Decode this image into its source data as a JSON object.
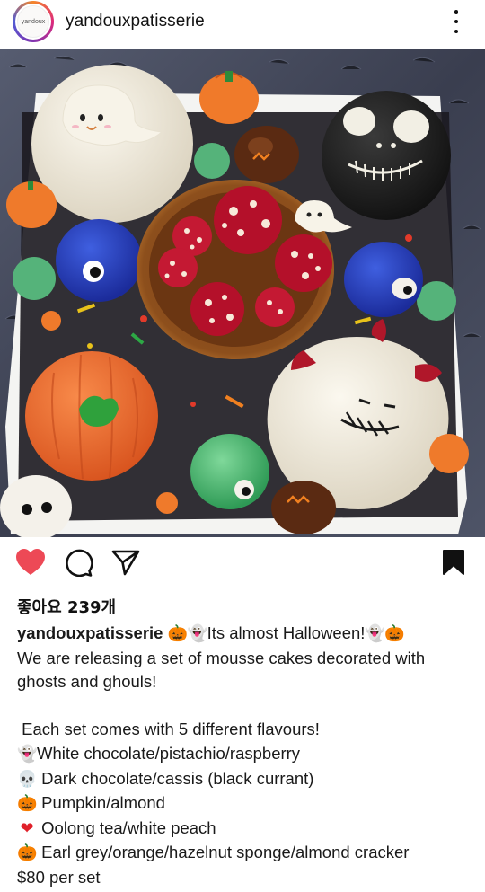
{
  "header": {
    "username": "yandouxpatisserie",
    "avatar_text": "yandoux",
    "more_icon": "more-vertical-icon"
  },
  "photo": {
    "description_icon": "photo"
  },
  "actions": {
    "like_color": "#ed4956",
    "like_icon": "heart-filled-icon",
    "comment_icon": "comment-icon",
    "share_icon": "send-icon",
    "save_icon": "bookmark-filled-icon"
  },
  "likes": {
    "text": "좋아요 239개"
  },
  "caption": {
    "username": "yandouxpatisserie",
    "first_line_emoji_a": "🎃",
    "first_line_emoji_b": "👻",
    "first_line_text": "Its almost Halloween!",
    "first_line_emoji_c": "👻",
    "first_line_emoji_d": "🎃",
    "line2": "We are releasing a set of mousse cakes decorated with",
    "line3": "ghosts and ghouls!",
    "line5": " Each set comes with 5 different flavours!",
    "flavours": [
      {
        "emoji": "👻",
        "text": "White chocolate/pistachio/raspberry"
      },
      {
        "emoji": "💀",
        "text": " Dark chocolate/cassis (black currant)"
      },
      {
        "emoji": "🎃",
        "text": " Pumpkin/almond"
      },
      {
        "emoji": "❤",
        "text": " Oolong tea/white peach"
      },
      {
        "emoji": "🎃",
        "text": " Earl grey/orange/hazelnut sponge/almond cracker"
      }
    ],
    "price": "$80 per set"
  }
}
